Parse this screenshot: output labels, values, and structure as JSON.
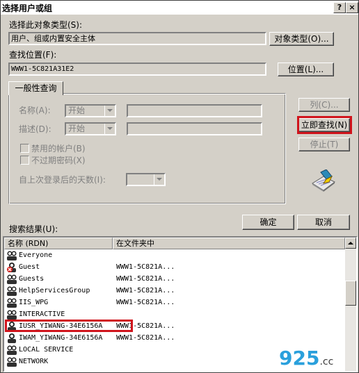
{
  "window": {
    "title": "选择用户或组",
    "help_label": "?",
    "close_label": "×"
  },
  "object_type": {
    "label": "选择此对象类型(S):",
    "value": "用户、组或内置安全主体",
    "button": "对象类型(O)..."
  },
  "location": {
    "label": "查找位置(F):",
    "value": "WWW1-5C821A31E2",
    "button": "位置(L)..."
  },
  "query": {
    "tab_label": "一般性查询",
    "name_label": "名称(A):",
    "name_mode": "开始",
    "desc_label": "描述(D):",
    "desc_mode": "开始",
    "disabled_accounts": "禁用的帐户(B)",
    "non_expiring": "不过期密码(X)",
    "days_label": "自上次登录后的天数(I):"
  },
  "side_buttons": {
    "columns": "列(C)...",
    "find_now": "立即查找(N)",
    "stop": "停止(T)"
  },
  "ok_button": "确定",
  "cancel_button": "取消",
  "results": {
    "label": "搜索结果(U):",
    "col_name": "名称 (RDN)",
    "col_folder": "在文件夹中",
    "rows": [
      {
        "name": "Everyone",
        "folder": ""
      },
      {
        "name": "Guest",
        "folder": "WWW1-5C821A..."
      },
      {
        "name": "Guests",
        "folder": "WWW1-5C821A..."
      },
      {
        "name": "HelpServicesGroup",
        "folder": "WWW1-5C821A..."
      },
      {
        "name": "IIS_WPG",
        "folder": "WWW1-5C821A..."
      },
      {
        "name": "INTERACTIVE",
        "folder": ""
      },
      {
        "name": "IUSR_YIWANG-34E6156A",
        "folder": "WWW1-5C821A..."
      },
      {
        "name": "IWAM_YIWANG-34E6156A",
        "folder": "WWW1-5C821A..."
      },
      {
        "name": "LOCAL SERVICE",
        "folder": ""
      },
      {
        "name": "NETWORK",
        "folder": ""
      }
    ]
  },
  "watermark": {
    "main": "925",
    "suffix": ".cc"
  },
  "colors": {
    "highlight_red": "#d0141c",
    "dialog_face": "#d4d0c8"
  }
}
